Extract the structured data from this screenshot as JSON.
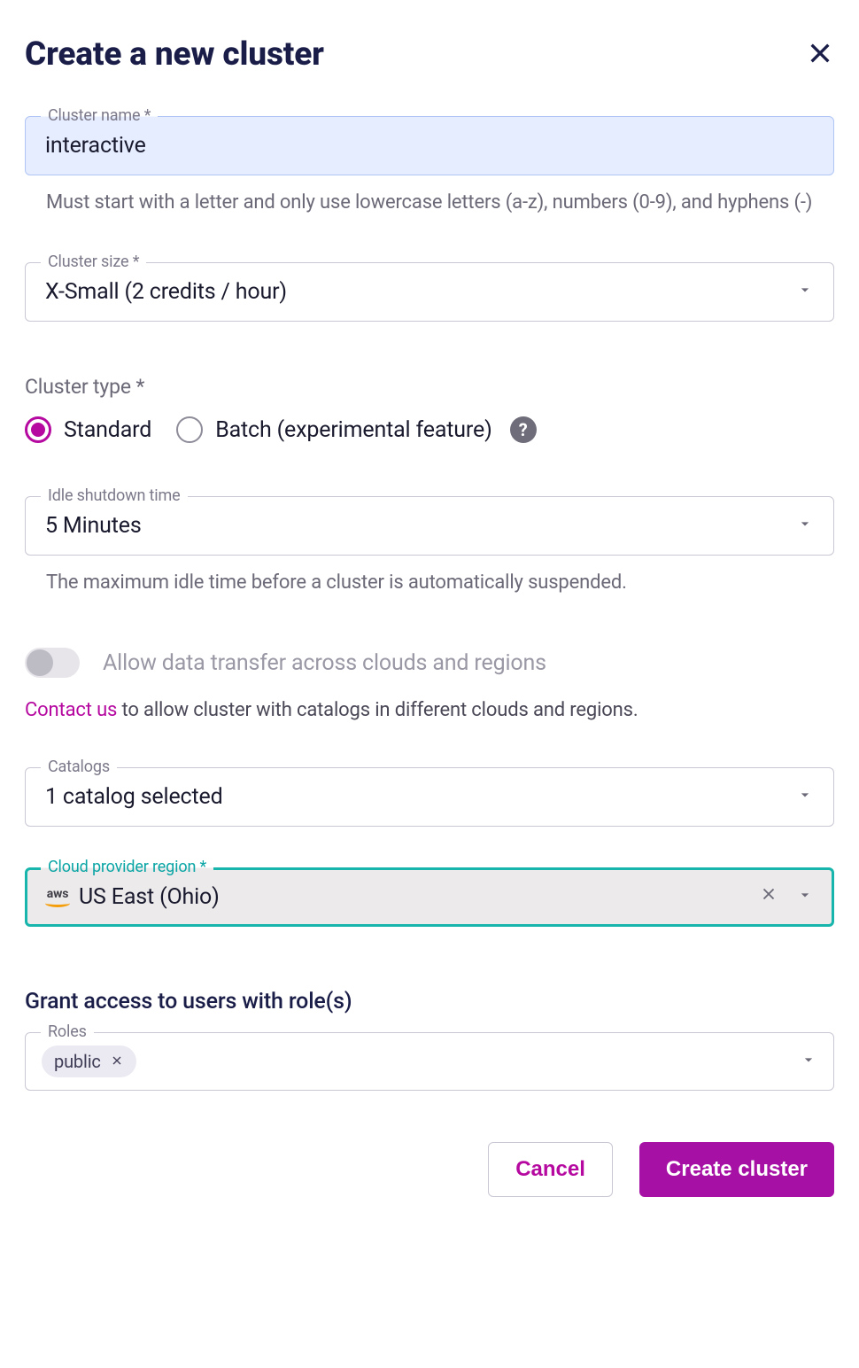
{
  "header": {
    "title": "Create a new cluster"
  },
  "cluster_name": {
    "label": "Cluster name *",
    "value": "interactive",
    "helper": "Must start with a letter and only use lowercase letters (a-z), numbers (0-9), and hyphens (-)"
  },
  "cluster_size": {
    "label": "Cluster size *",
    "value": "X-Small (2 credits / hour)"
  },
  "cluster_type": {
    "label": "Cluster type *",
    "options": {
      "standard": "Standard",
      "batch": "Batch (experimental feature)"
    },
    "selected": "standard"
  },
  "idle_shutdown": {
    "label": "Idle shutdown time",
    "value": "5 Minutes",
    "helper": "The maximum idle time before a cluster is automatically suspended."
  },
  "cross_cloud": {
    "toggle_label": "Allow data transfer across clouds and regions",
    "contact_link": "Contact us",
    "contact_rest": " to allow cluster with catalogs in different clouds and regions."
  },
  "catalogs": {
    "label": "Catalogs",
    "value": "1 catalog selected"
  },
  "region": {
    "label": "Cloud provider region *",
    "provider_icon": "aws",
    "value": "US East (Ohio)"
  },
  "roles": {
    "heading": "Grant access to users with role(s)",
    "label": "Roles",
    "chips": [
      "public"
    ]
  },
  "buttons": {
    "cancel": "Cancel",
    "create": "Create cluster"
  }
}
